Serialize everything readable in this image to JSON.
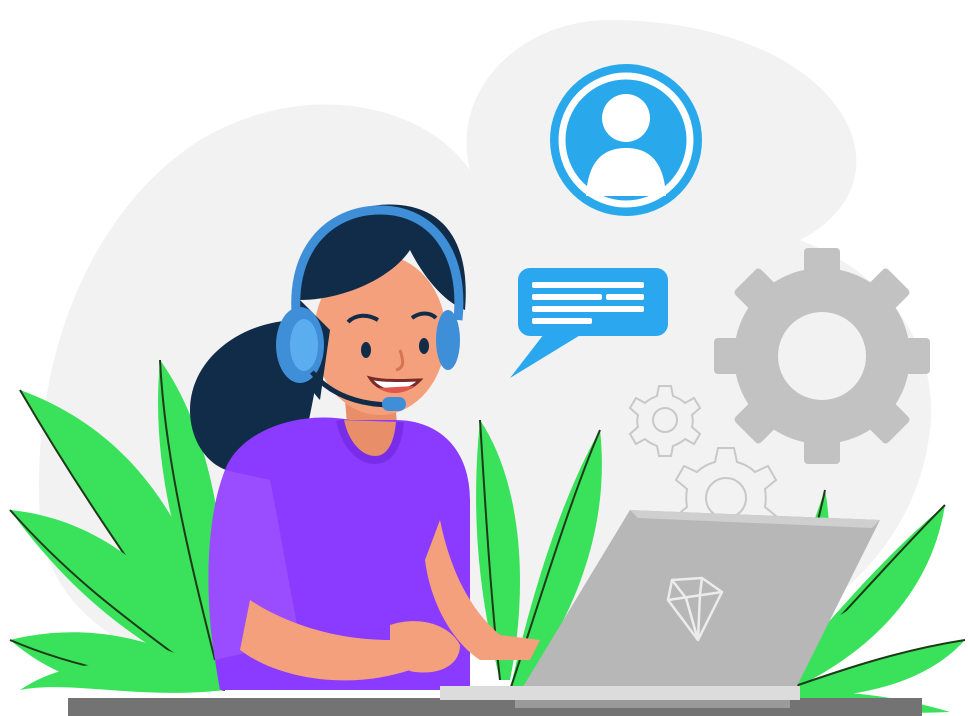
{
  "colors": {
    "background_blob": "#f2f2f2",
    "avatar_blue": "#29a9ec",
    "bubble_blue": "#2aa7ef",
    "bubble_line": "#ffffff",
    "gear_gray": "#c2c2c2",
    "gear_outline": "#c8c8c8",
    "leaf_green": "#39e25a",
    "leaf_vein": "#1e3a18",
    "hair": "#102c48",
    "skin": "#f5a07c",
    "shirt": "#8b3bff",
    "shirt_shadow": "#7a2de8",
    "headset": "#3f8ed8",
    "laptop": "#b7b7b7",
    "laptop_dark": "#9a9a9a",
    "desk": "#737373"
  },
  "icons": [
    "user-avatar-icon",
    "chat-bubble-icon",
    "large-gear-icon",
    "small-gear-icon",
    "medium-gear-icon",
    "diamond-logo-icon"
  ]
}
